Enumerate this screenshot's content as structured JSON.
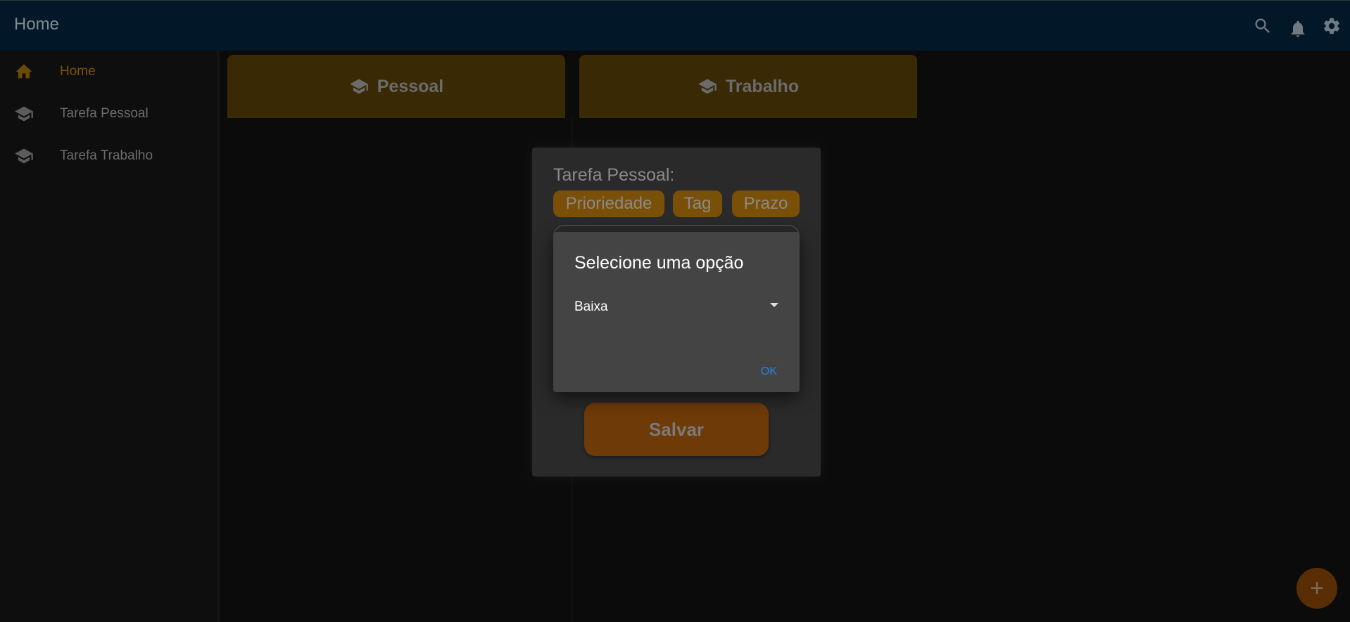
{
  "appbar": {
    "title": "Home",
    "icons": [
      "search-icon",
      "bell-icon",
      "gear-icon"
    ]
  },
  "sidebar": {
    "items": [
      {
        "label": "Home",
        "icon": "home-icon",
        "active": true
      },
      {
        "label": "Tarefa Pessoal",
        "icon": "school-icon",
        "active": false
      },
      {
        "label": "Tarefa Trabalho",
        "icon": "school-icon",
        "active": false
      }
    ]
  },
  "categories": [
    {
      "label": "Pessoal",
      "icon": "school-icon"
    },
    {
      "label": "Trabalho",
      "icon": "school-icon"
    }
  ],
  "form": {
    "title": "Tarefa Pessoal:",
    "chips": [
      "Prioriedade",
      "Tag",
      "Prazo"
    ],
    "save_label": "Salvar"
  },
  "dialog": {
    "title": "Selecione uma opção",
    "selected_value": "Baixa",
    "ok_label": "OK"
  },
  "fab": {
    "label": "+"
  },
  "colors": {
    "appbar": "#021828",
    "accent": "#7a4f07",
    "dialog": "#444444",
    "ok_link": "#1e88e5"
  }
}
